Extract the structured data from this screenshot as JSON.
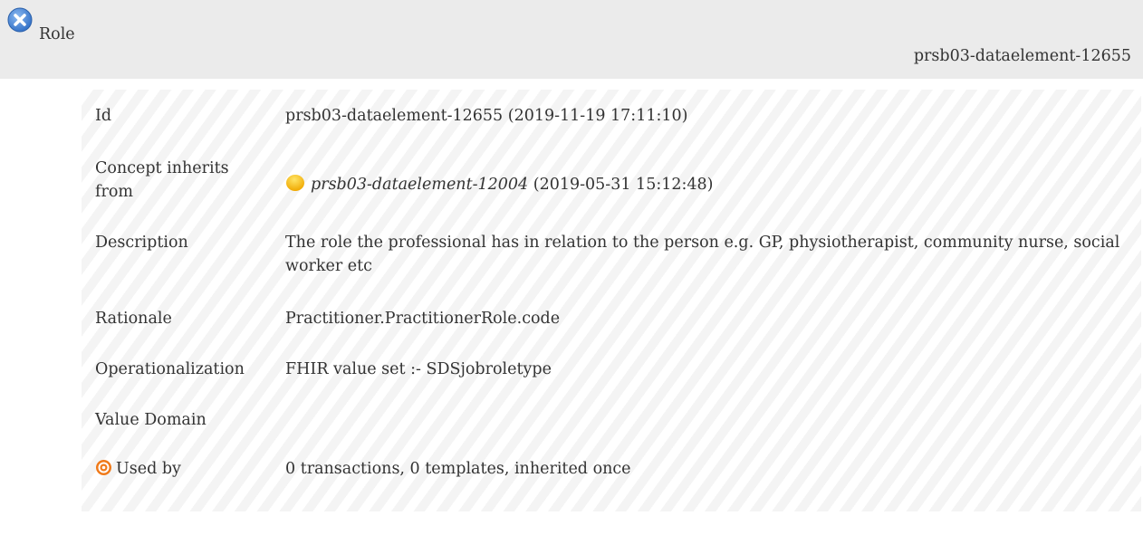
{
  "header": {
    "title": "Role",
    "id": "prsb03-dataelement-12655",
    "close_icon": "close-circle-icon",
    "icon_color": "#4f8fd9"
  },
  "details": {
    "id": {
      "label": "Id",
      "value": "prsb03-dataelement-12655 (2019-11-19 17:11:10)"
    },
    "inherits": {
      "label": "Concept inherits from",
      "link": "prsb03-dataelement-12004",
      "date": "(2019-05-31 15:12:48)",
      "status_icon": "status-dot-icon",
      "status_color": "#f5b800"
    },
    "description": {
      "label": "Description",
      "value": "The role the professional has in relation to the person e.g. GP, physiotherapist, community nurse, social worker etc"
    },
    "rationale": {
      "label": "Rationale",
      "value": "Practitioner.PractitionerRole.code"
    },
    "operationalization": {
      "label": "Operationalization",
      "value": "FHIR value set :- SDSjobroletype"
    },
    "value_domain": {
      "label": "Value Domain",
      "value": ""
    },
    "used_by": {
      "label": "Used by",
      "value": "0 transactions, 0 templates, inherited once",
      "icon": "target-icon",
      "icon_color": "#f07a1a"
    }
  }
}
